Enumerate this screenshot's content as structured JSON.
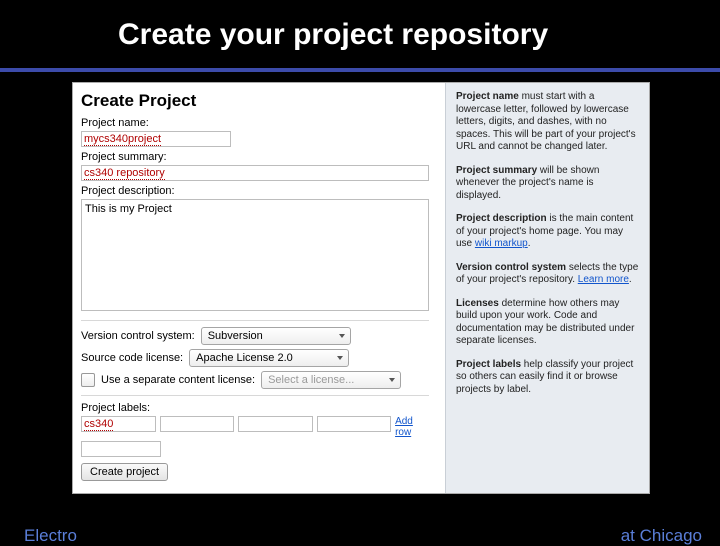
{
  "slide": {
    "title": "Create  your project repository"
  },
  "form": {
    "heading": "Create Project",
    "name": {
      "label": "Project name:",
      "value": "mycs340project"
    },
    "summary": {
      "label": "Project summary:",
      "value": "cs340 repository"
    },
    "description": {
      "label": "Project description:",
      "value": "This is my Project"
    },
    "vcs": {
      "label": "Version control system:",
      "value": "Subversion"
    },
    "license": {
      "label": "Source code license:",
      "value": "Apache License 2.0"
    },
    "separate_license": {
      "checkbox_label": "Use a separate content license:",
      "placeholder": "Select a license..."
    },
    "labels": {
      "label": "Project labels:",
      "values": [
        "cs340",
        "",
        "",
        "",
        ""
      ],
      "add_row": "Add row"
    },
    "submit": "Create project"
  },
  "side": {
    "p1a": "Project name",
    "p1b": " must start with a lowercase letter, followed by lowercase letters, digits, and dashes, with no spaces. This will be part of your project's URL and cannot be changed later.",
    "p2a": "Project summary",
    "p2b": " will be shown whenever the project's name is displayed.",
    "p3a": "Project description",
    "p3b": " is the main content of your project's home page. You may use ",
    "p3link": "wiki markup",
    "p3c": ".",
    "p4a": "Version control system",
    "p4b": " selects the type of your project's repository. ",
    "p4link": "Learn more",
    "p4c": ".",
    "p5a": "Licenses",
    "p5b": " determine how others may build upon your work. Code and documentation may be distributed under separate licenses.",
    "p6a": "Project labels",
    "p6b": " help classify your project so others can easily find it or browse projects by label."
  },
  "footer": {
    "left": "Electro",
    "right": "at Chicago"
  }
}
